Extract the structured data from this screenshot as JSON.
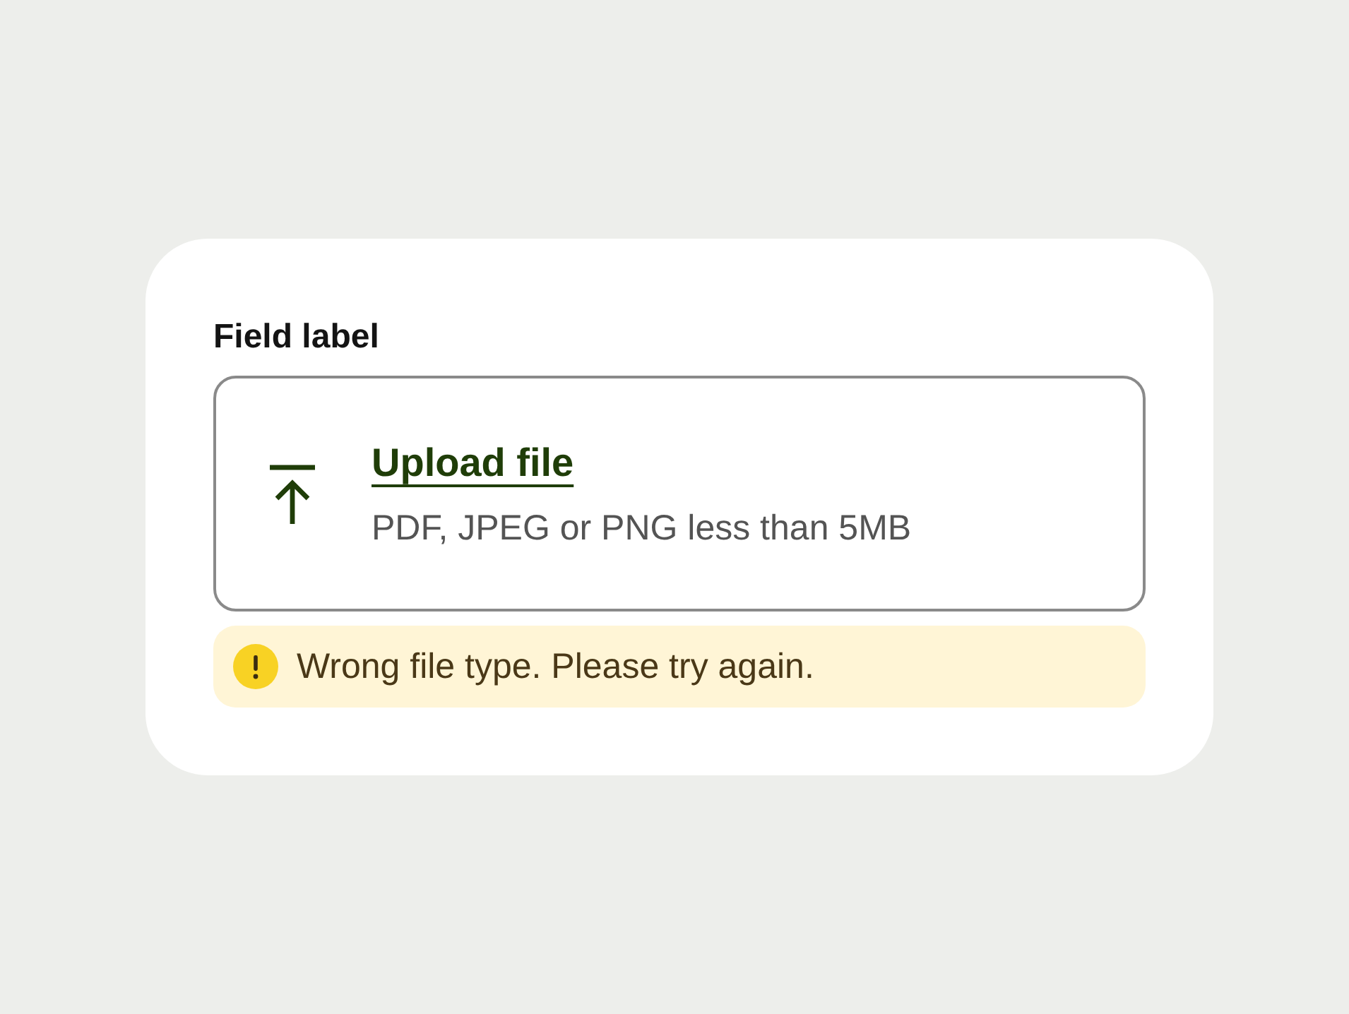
{
  "field": {
    "label": "Field label"
  },
  "upload": {
    "link": "Upload file",
    "hint": "PDF, JPEG or PNG less than 5MB"
  },
  "error": {
    "message": "Wrong file type. Please try again."
  }
}
